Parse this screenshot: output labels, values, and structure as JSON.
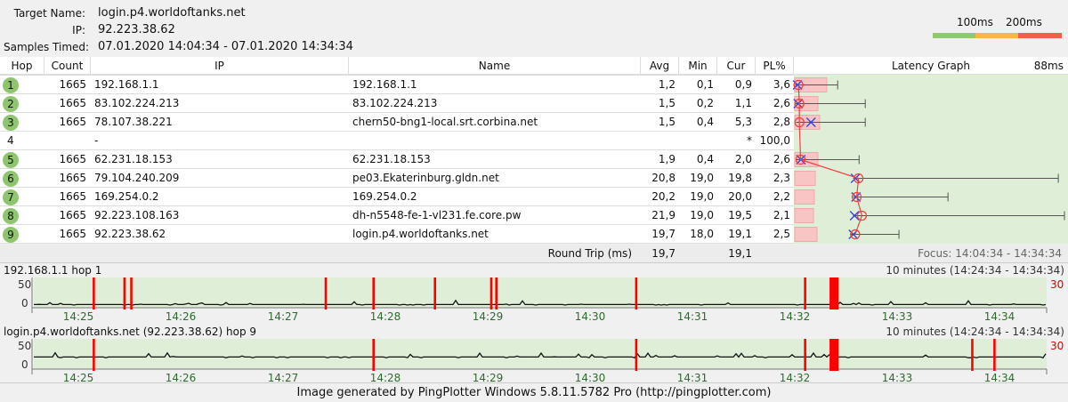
{
  "header": {
    "target_label": "Target Name:",
    "target": "login.p4.worldoftanks.net",
    "ip_label": "IP:",
    "ip": "92.223.38.62",
    "samples_label": "Samples Timed:",
    "samples": "07.01.2020 14:04:34 - 07.01.2020 14:34:34"
  },
  "legend": {
    "l1": "100ms",
    "l2": "200ms",
    "colors": [
      "#8dc96e",
      "#f8b54a",
      "#f0604a"
    ]
  },
  "columns": {
    "hop": "Hop",
    "count": "Count",
    "ip": "IP",
    "name": "Name",
    "avg": "Avg",
    "min": "Min",
    "cur": "Cur",
    "pl": "PL%",
    "graph": "Latency Graph",
    "scale": "88ms"
  },
  "rows": [
    {
      "hop": "1",
      "count": "1665",
      "ip": "192.168.1.1",
      "name": "192.168.1.1",
      "avg": "1,2",
      "min": "0,1",
      "cur": "0,9",
      "pl": "3,6"
    },
    {
      "hop": "2",
      "count": "1665",
      "ip": "83.102.224.213",
      "name": "83.102.224.213",
      "avg": "1,5",
      "min": "0,2",
      "cur": "1,1",
      "pl": "2,6"
    },
    {
      "hop": "3",
      "count": "1665",
      "ip": "78.107.38.221",
      "name": "chern50-bng1-local.srt.corbina.net",
      "avg": "1,5",
      "min": "0,4",
      "cur": "5,3",
      "pl": "2,8"
    },
    {
      "hop": "4",
      "count": "",
      "ip": "-",
      "name": "",
      "avg": "",
      "min": "",
      "cur": "*",
      "pl": "100,0"
    },
    {
      "hop": "5",
      "count": "1665",
      "ip": "62.231.18.153",
      "name": "62.231.18.153",
      "avg": "1,9",
      "min": "0,4",
      "cur": "2,0",
      "pl": "2,6"
    },
    {
      "hop": "6",
      "count": "1665",
      "ip": "79.104.240.209",
      "name": "pe03.Ekaterinburg.gldn.net",
      "avg": "20,8",
      "min": "19,0",
      "cur": "19,8",
      "pl": "2,3"
    },
    {
      "hop": "7",
      "count": "1665",
      "ip": "169.254.0.2",
      "name": "169.254.0.2",
      "avg": "20,2",
      "min": "19,0",
      "cur": "20,0",
      "pl": "2,2"
    },
    {
      "hop": "8",
      "count": "1665",
      "ip": "92.223.108.163",
      "name": "dh-n5548-fe-1-vl231.fe.core.pw",
      "avg": "21,9",
      "min": "19,0",
      "cur": "19,5",
      "pl": "2,1"
    },
    {
      "hop": "9",
      "count": "1665",
      "ip": "92.223.38.62",
      "name": "login.p4.worldoftanks.net",
      "avg": "19,7",
      "min": "18,0",
      "cur": "19,1",
      "pl": "2,5"
    }
  ],
  "roundtrip": {
    "label": "Round Trip (ms)",
    "avg": "19,7",
    "cur": "19,1",
    "focus": "Focus: 14:04:34 - 14:34:34"
  },
  "chart_data": [
    {
      "type": "line",
      "title": "192.168.1.1 hop 1",
      "range_label": "10 minutes (14:24:34 - 14:34:34)",
      "y_ticks": [
        "50",
        "0"
      ],
      "right_label": "30",
      "x_ticks": [
        "14:25",
        "14:26",
        "14:27",
        "14:28",
        "14:29",
        "14:30",
        "14:31",
        "14:32",
        "14:33",
        "14:34"
      ],
      "baseline_ms": 1,
      "loss_seconds": [
        35,
        53,
        57,
        171,
        199,
        235,
        268,
        271,
        353,
        452,
        467,
        468,
        469,
        470,
        471
      ]
    },
    {
      "type": "line",
      "title": "login.p4.worldoftanks.net (92.223.38.62) hop 9",
      "range_label": "10 minutes (14:24:34 - 14:34:34)",
      "y_ticks": [
        "50",
        "0"
      ],
      "right_label": "30",
      "x_ticks": [
        "14:25",
        "14:26",
        "14:27",
        "14:28",
        "14:29",
        "14:30",
        "14:31",
        "14:32",
        "14:33",
        "14:34"
      ],
      "baseline_ms": 19,
      "loss_seconds": [
        35,
        199,
        353,
        452,
        467,
        468,
        469,
        470,
        471,
        550,
        563
      ]
    }
  ],
  "latency_graph": {
    "max_ms": 88,
    "max_est": [
      14,
      23,
      23,
      null,
      21,
      86,
      50,
      88,
      34
    ]
  },
  "footer": "Image generated by PingPlotter Windows 5.8.11.5782 Pro (http://pingplotter.com)"
}
